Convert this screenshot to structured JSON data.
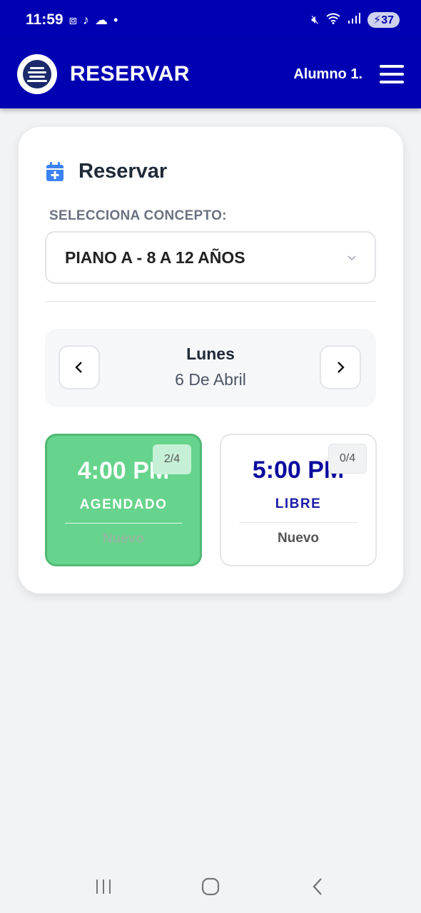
{
  "status_bar": {
    "time": "11:59",
    "battery": "37"
  },
  "app_bar": {
    "title": "RESERVAR",
    "user": "Alumno 1."
  },
  "card": {
    "title": "Reservar",
    "concept_label": "SELECCIONA CONCEPTO:",
    "concept_value": "PIANO A - 8 A 12 AÑOS",
    "day_name": "Lunes",
    "day_date": "6 De Abril"
  },
  "slots": [
    {
      "time": "4:00 PM",
      "badge": "2/4",
      "status": "AGENDADO",
      "sub": "Nuevo"
    },
    {
      "time": "5:00 PM",
      "badge": "0/4",
      "status": "LIBRE",
      "sub": "Nuevo"
    }
  ],
  "colors": {
    "brand": "#0000b3",
    "booked": "#66d48c",
    "accent_icon": "#3b82f6"
  }
}
